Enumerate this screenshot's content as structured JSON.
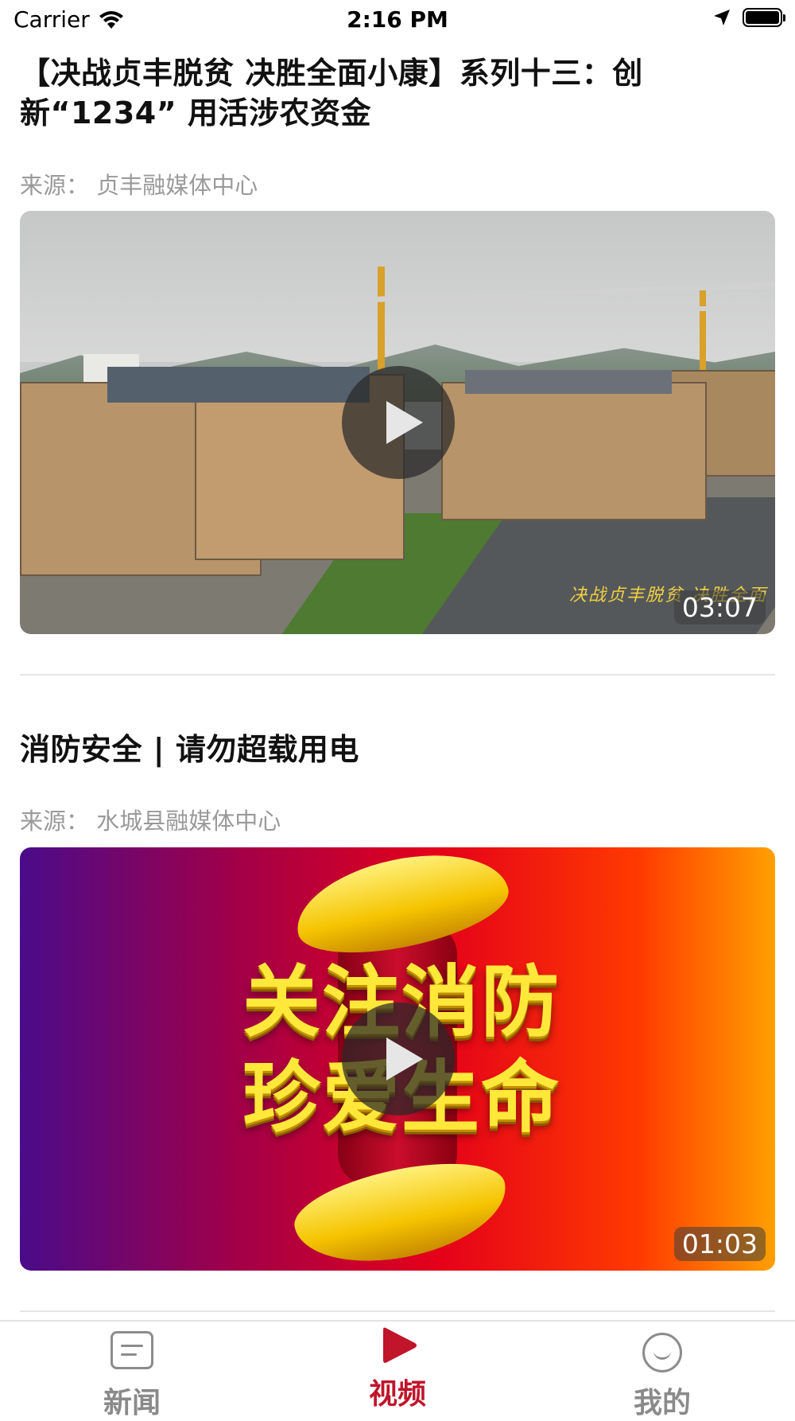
{
  "status_bar": {
    "carrier": "Carrier",
    "time": "2:16 PM"
  },
  "feed": [
    {
      "title": "【决战贞丰脱贫 决胜全面小康】系列十三：创新“1234” 用活涉农资金",
      "source": "来源：  贞丰融媒体中心",
      "duration": "03:07",
      "overlay_caption": "决战贞丰脱贫 决胜全面"
    },
    {
      "title": "消防安全 | 请勿超载用电",
      "source": "来源：  水城县融媒体中心",
      "duration": "01:03",
      "thumb_line1": "关注消防",
      "thumb_line2": "珍爱生命"
    }
  ],
  "tab_bar": {
    "tabs": [
      {
        "label": "新闻",
        "icon": "news-icon",
        "active": false
      },
      {
        "label": "视频",
        "icon": "play-icon",
        "active": true
      },
      {
        "label": "我的",
        "icon": "smile-icon",
        "active": false
      }
    ],
    "active_color": "#c0152a",
    "inactive_color": "#8a8a8a"
  }
}
